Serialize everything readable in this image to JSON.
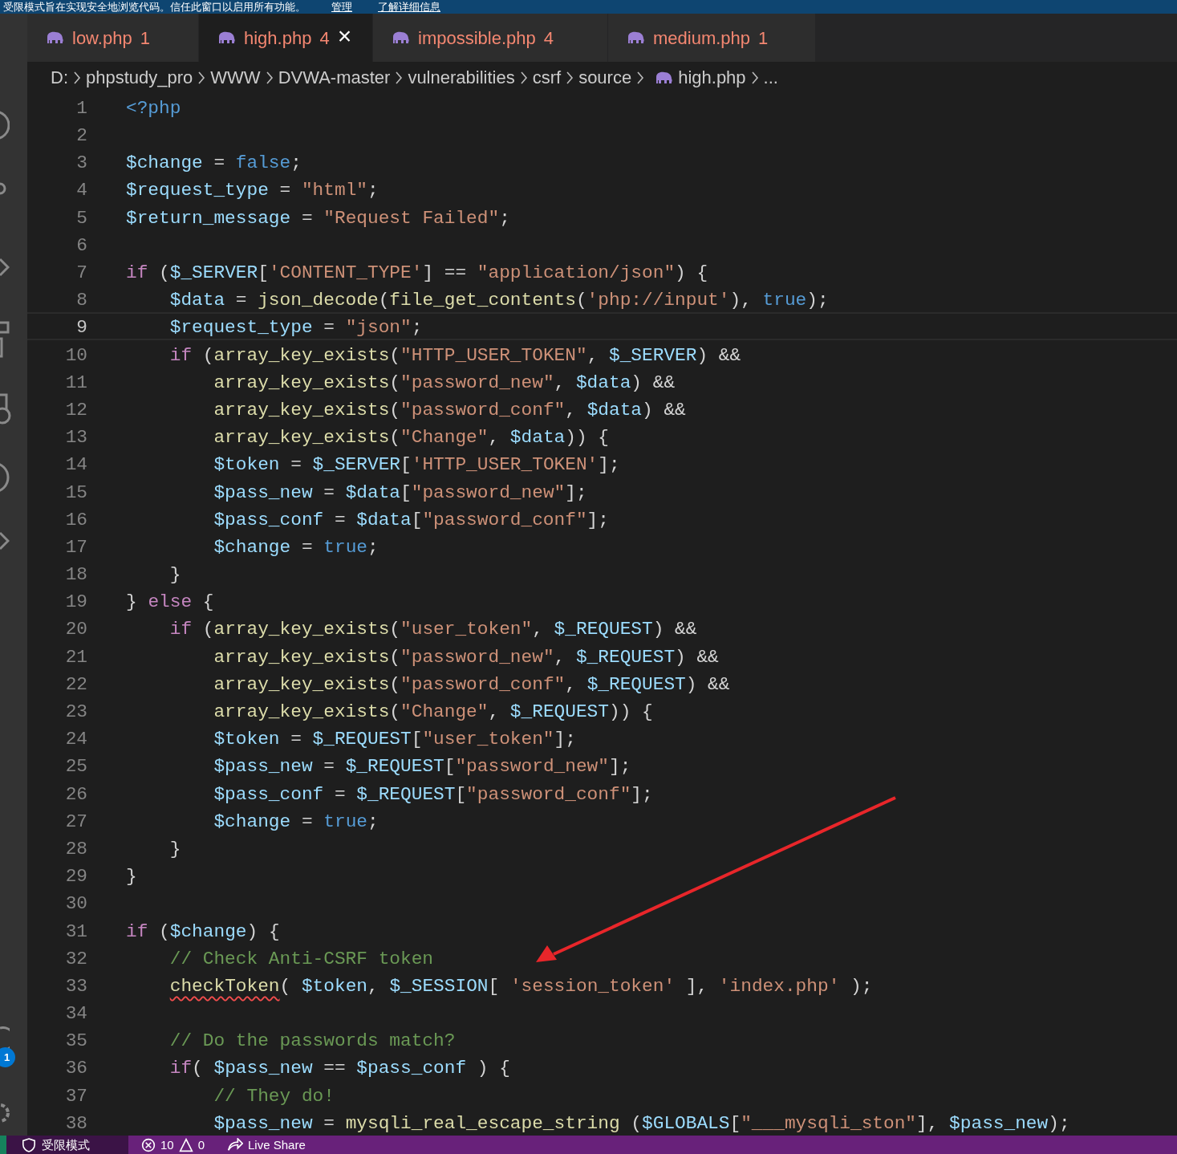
{
  "banner": {
    "message": "受限模式旨在实现安全地浏览代码。信任此窗口以启用所有功能。",
    "links": [
      "管理",
      "了解详细信息"
    ]
  },
  "tabs": [
    {
      "label": "low.php",
      "count": "1",
      "selected": false
    },
    {
      "label": "high.php",
      "count": "4",
      "selected": true,
      "close": "×"
    },
    {
      "label": "impossible.php",
      "count": "4",
      "selected": false
    },
    {
      "label": "medium.php",
      "count": "1",
      "selected": false
    }
  ],
  "breadcrumb": [
    "D:",
    "phpstudy_pro",
    "WWW",
    "DVWA-master",
    "vulnerabilities",
    "csrf",
    "source",
    "high.php",
    "..."
  ],
  "lines": [
    {
      "number": "1",
      "current": false,
      "tokens": [
        {
          "kind": "kw",
          "text": "<?php"
        }
      ]
    },
    {
      "number": "2",
      "current": false
    },
    {
      "number": "3",
      "current": false,
      "tokens": [
        {
          "kind": "var",
          "text": "$change"
        },
        {
          "kind": "p",
          "text": " = "
        },
        {
          "kind": "kw",
          "text": "false"
        },
        {
          "kind": "p",
          "text": ";"
        }
      ]
    },
    {
      "number": "4",
      "current": false,
      "tokens": [
        {
          "kind": "var",
          "text": "$request_type"
        },
        {
          "kind": "p",
          "text": " = "
        },
        {
          "kind": "str",
          "text": "\"html\""
        },
        {
          "kind": "p",
          "text": ";"
        }
      ]
    },
    {
      "number": "5",
      "current": false,
      "tokens": [
        {
          "kind": "var",
          "text": "$return_message"
        },
        {
          "kind": "p",
          "text": " = "
        },
        {
          "kind": "str",
          "text": "\"Request Failed\""
        },
        {
          "kind": "p",
          "text": ";"
        }
      ]
    },
    {
      "number": "6",
      "current": false
    },
    {
      "number": "7",
      "current": false,
      "tokens": [
        {
          "kind": "ctrl",
          "text": "if"
        },
        {
          "kind": "p",
          "text": " ("
        },
        {
          "kind": "var",
          "text": "$_SERVER"
        },
        {
          "kind": "p",
          "text": "["
        },
        {
          "kind": "str",
          "text": "'CONTENT_TYPE'"
        },
        {
          "kind": "p",
          "text": "] == "
        },
        {
          "kind": "str",
          "text": "\"application/json\""
        },
        {
          "kind": "p",
          "text": ") {"
        }
      ]
    },
    {
      "number": "8",
      "current": false,
      "tokens": [
        {
          "kind": "var",
          "text": "    $data"
        },
        {
          "kind": "p",
          "text": " = "
        },
        {
          "kind": "fn",
          "text": "json_decode"
        },
        {
          "kind": "p",
          "text": "("
        },
        {
          "kind": "fn",
          "text": "file_get_contents"
        },
        {
          "kind": "p",
          "text": "("
        },
        {
          "kind": "str",
          "text": "'php://input'"
        },
        {
          "kind": "p",
          "text": "), "
        },
        {
          "kind": "kw",
          "text": "true"
        },
        {
          "kind": "p",
          "text": ");"
        }
      ]
    },
    {
      "number": "9",
      "current": true,
      "tokens": [
        {
          "kind": "var",
          "text": "    $request_type"
        },
        {
          "kind": "p",
          "text": " = "
        },
        {
          "kind": "str",
          "text": "\"json\""
        },
        {
          "kind": "p",
          "text": ";"
        }
      ]
    },
    {
      "number": "10",
      "current": false,
      "tokens": [
        {
          "kind": "ctrl",
          "text": "    if"
        },
        {
          "kind": "p",
          "text": " ("
        },
        {
          "kind": "fn",
          "text": "array_key_exists"
        },
        {
          "kind": "p",
          "text": "("
        },
        {
          "kind": "str",
          "text": "\"HTTP_USER_TOKEN\""
        },
        {
          "kind": "p",
          "text": ", "
        },
        {
          "kind": "var",
          "text": "$_SERVER"
        },
        {
          "kind": "p",
          "text": ") &&"
        }
      ]
    },
    {
      "number": "11",
      "current": false,
      "tokens": [
        {
          "kind": "fn",
          "text": "        array_key_exists"
        },
        {
          "kind": "p",
          "text": "("
        },
        {
          "kind": "str",
          "text": "\"password_new\""
        },
        {
          "kind": "p",
          "text": ", "
        },
        {
          "kind": "var",
          "text": "$data"
        },
        {
          "kind": "p",
          "text": ") &&"
        }
      ]
    },
    {
      "number": "12",
      "current": false,
      "tokens": [
        {
          "kind": "fn",
          "text": "        array_key_exists"
        },
        {
          "kind": "p",
          "text": "("
        },
        {
          "kind": "str",
          "text": "\"password_conf\""
        },
        {
          "kind": "p",
          "text": ", "
        },
        {
          "kind": "var",
          "text": "$data"
        },
        {
          "kind": "p",
          "text": ") &&"
        }
      ]
    },
    {
      "number": "13",
      "current": false,
      "tokens": [
        {
          "kind": "fn",
          "text": "        array_key_exists"
        },
        {
          "kind": "p",
          "text": "("
        },
        {
          "kind": "str",
          "text": "\"Change\""
        },
        {
          "kind": "p",
          "text": ", "
        },
        {
          "kind": "var",
          "text": "$data"
        },
        {
          "kind": "p",
          "text": ")) {"
        }
      ]
    },
    {
      "number": "14",
      "current": false,
      "tokens": [
        {
          "kind": "var",
          "text": "        $token"
        },
        {
          "kind": "p",
          "text": " = "
        },
        {
          "kind": "var",
          "text": "$_SERVER"
        },
        {
          "kind": "p",
          "text": "["
        },
        {
          "kind": "str",
          "text": "'HTTP_USER_TOKEN'"
        },
        {
          "kind": "p",
          "text": "];"
        }
      ]
    },
    {
      "number": "15",
      "current": false,
      "tokens": [
        {
          "kind": "var",
          "text": "        $pass_new"
        },
        {
          "kind": "p",
          "text": " = "
        },
        {
          "kind": "var",
          "text": "$data"
        },
        {
          "kind": "p",
          "text": "["
        },
        {
          "kind": "str",
          "text": "\"password_new\""
        },
        {
          "kind": "p",
          "text": "];"
        }
      ]
    },
    {
      "number": "16",
      "current": false,
      "tokens": [
        {
          "kind": "var",
          "text": "        $pass_conf"
        },
        {
          "kind": "p",
          "text": " = "
        },
        {
          "kind": "var",
          "text": "$data"
        },
        {
          "kind": "p",
          "text": "["
        },
        {
          "kind": "str",
          "text": "\"password_conf\""
        },
        {
          "kind": "p",
          "text": "];"
        }
      ]
    },
    {
      "number": "17",
      "current": false,
      "tokens": [
        {
          "kind": "var",
          "text": "        $change"
        },
        {
          "kind": "p",
          "text": " = "
        },
        {
          "kind": "kw",
          "text": "true"
        },
        {
          "kind": "p",
          "text": ";"
        }
      ]
    },
    {
      "number": "18",
      "current": false,
      "tokens": [
        {
          "kind": "p",
          "text": "    }"
        }
      ]
    },
    {
      "number": "19",
      "current": false,
      "tokens": [
        {
          "kind": "p",
          "text": "} "
        },
        {
          "kind": "ctrl",
          "text": "else"
        },
        {
          "kind": "p",
          "text": " {"
        }
      ]
    },
    {
      "number": "20",
      "current": false,
      "tokens": [
        {
          "kind": "ctrl",
          "text": "    if"
        },
        {
          "kind": "p",
          "text": " ("
        },
        {
          "kind": "fn",
          "text": "array_key_exists"
        },
        {
          "kind": "p",
          "text": "("
        },
        {
          "kind": "str",
          "text": "\"user_token\""
        },
        {
          "kind": "p",
          "text": ", "
        },
        {
          "kind": "var",
          "text": "$_REQUEST"
        },
        {
          "kind": "p",
          "text": ") &&"
        }
      ]
    },
    {
      "number": "21",
      "current": false,
      "tokens": [
        {
          "kind": "fn",
          "text": "        array_key_exists"
        },
        {
          "kind": "p",
          "text": "("
        },
        {
          "kind": "str",
          "text": "\"password_new\""
        },
        {
          "kind": "p",
          "text": ", "
        },
        {
          "kind": "var",
          "text": "$_REQUEST"
        },
        {
          "kind": "p",
          "text": ") &&"
        }
      ]
    },
    {
      "number": "22",
      "current": false,
      "tokens": [
        {
          "kind": "fn",
          "text": "        array_key_exists"
        },
        {
          "kind": "p",
          "text": "("
        },
        {
          "kind": "str",
          "text": "\"password_conf\""
        },
        {
          "kind": "p",
          "text": ", "
        },
        {
          "kind": "var",
          "text": "$_REQUEST"
        },
        {
          "kind": "p",
          "text": ") &&"
        }
      ]
    },
    {
      "number": "23",
      "current": false,
      "tokens": [
        {
          "kind": "fn",
          "text": "        array_key_exists"
        },
        {
          "kind": "p",
          "text": "("
        },
        {
          "kind": "str",
          "text": "\"Change\""
        },
        {
          "kind": "p",
          "text": ", "
        },
        {
          "kind": "var",
          "text": "$_REQUEST"
        },
        {
          "kind": "p",
          "text": ")) {"
        }
      ]
    },
    {
      "number": "24",
      "current": false,
      "tokens": [
        {
          "kind": "var",
          "text": "        $token"
        },
        {
          "kind": "p",
          "text": " = "
        },
        {
          "kind": "var",
          "text": "$_REQUEST"
        },
        {
          "kind": "p",
          "text": "["
        },
        {
          "kind": "str",
          "text": "\"user_token\""
        },
        {
          "kind": "p",
          "text": "];"
        }
      ]
    },
    {
      "number": "25",
      "current": false,
      "tokens": [
        {
          "kind": "var",
          "text": "        $pass_new"
        },
        {
          "kind": "p",
          "text": " = "
        },
        {
          "kind": "var",
          "text": "$_REQUEST"
        },
        {
          "kind": "p",
          "text": "["
        },
        {
          "kind": "str",
          "text": "\"password_new\""
        },
        {
          "kind": "p",
          "text": "];"
        }
      ]
    },
    {
      "number": "26",
      "current": false,
      "tokens": [
        {
          "kind": "var",
          "text": "        $pass_conf"
        },
        {
          "kind": "p",
          "text": " = "
        },
        {
          "kind": "var",
          "text": "$_REQUEST"
        },
        {
          "kind": "p",
          "text": "["
        },
        {
          "kind": "str",
          "text": "\"password_conf\""
        },
        {
          "kind": "p",
          "text": "];"
        }
      ]
    },
    {
      "number": "27",
      "current": false,
      "tokens": [
        {
          "kind": "var",
          "text": "        $change"
        },
        {
          "kind": "p",
          "text": " = "
        },
        {
          "kind": "kw",
          "text": "true"
        },
        {
          "kind": "p",
          "text": ";"
        }
      ]
    },
    {
      "number": "28",
      "current": false,
      "tokens": [
        {
          "kind": "p",
          "text": "    }"
        }
      ]
    },
    {
      "number": "29",
      "current": false,
      "tokens": [
        {
          "kind": "p",
          "text": "}"
        }
      ]
    },
    {
      "number": "30",
      "current": false
    },
    {
      "number": "31",
      "current": false,
      "tokens": [
        {
          "kind": "ctrl",
          "text": "if"
        },
        {
          "kind": "p",
          "text": " ("
        },
        {
          "kind": "var",
          "text": "$change"
        },
        {
          "kind": "p",
          "text": ") {"
        }
      ]
    },
    {
      "number": "32",
      "current": false,
      "tokens": [
        {
          "kind": "cm",
          "text": "    // Check Anti-CSRF token"
        }
      ]
    },
    {
      "number": "33",
      "current": false,
      "tokens": [
        {
          "kind": "err",
          "text": "    checkToken"
        },
        {
          "kind": "p",
          "text": "( "
        },
        {
          "kind": "var",
          "text": "$token"
        },
        {
          "kind": "p",
          "text": ", "
        },
        {
          "kind": "var",
          "text": "$_SESSION"
        },
        {
          "kind": "p",
          "text": "[ "
        },
        {
          "kind": "str",
          "text": "'session_token'"
        },
        {
          "kind": "p",
          "text": " ], "
        },
        {
          "kind": "str",
          "text": "'index.php'"
        },
        {
          "kind": "p",
          "text": " );"
        }
      ]
    },
    {
      "number": "34",
      "current": false
    },
    {
      "number": "35",
      "current": false,
      "tokens": [
        {
          "kind": "cm",
          "text": "    // Do the passwords match?"
        }
      ]
    },
    {
      "number": "36",
      "current": false,
      "tokens": [
        {
          "kind": "ctrl",
          "text": "    if"
        },
        {
          "kind": "p",
          "text": "( "
        },
        {
          "kind": "var",
          "text": "$pass_new"
        },
        {
          "kind": "p",
          "text": " == "
        },
        {
          "kind": "var",
          "text": "$pass_conf"
        },
        {
          "kind": "p",
          "text": " ) {"
        }
      ]
    },
    {
      "number": "37",
      "current": false,
      "tokens": [
        {
          "kind": "cm",
          "text": "        // They do!"
        }
      ]
    },
    {
      "number": "38",
      "current": false,
      "tokens": [
        {
          "kind": "var",
          "text": "        $pass_new"
        },
        {
          "kind": "p",
          "text": " = "
        },
        {
          "kind": "fn",
          "text": "mysqli_real_escape_string"
        },
        {
          "kind": "p",
          "text": " ("
        },
        {
          "kind": "var",
          "text": "$GLOBALS"
        },
        {
          "kind": "p",
          "text": "["
        },
        {
          "kind": "str",
          "text": "\"___mysqli_ston\""
        },
        {
          "kind": "p",
          "text": "], "
        },
        {
          "kind": "var",
          "text": "$pass_new"
        },
        {
          "kind": "p",
          "text": ");"
        }
      ]
    }
  ],
  "activity_badge": "1",
  "status_bar": {
    "mode": "受限模式",
    "errors": "10",
    "warnings": "0",
    "live_share": "Live Share"
  }
}
